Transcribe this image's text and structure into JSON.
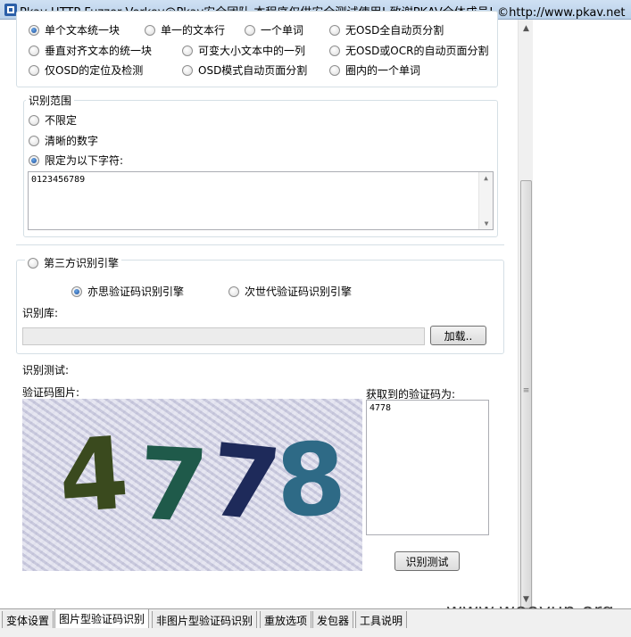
{
  "window": {
    "title": "Pkav HTTP Fuzzer   Verkey@Pkav安全团队  本程序仅供安全测试使用! 致谢PKAV全体成员! ©http://www.pkav.net"
  },
  "osd_modes": {
    "row1": [
      "单个文本统一块",
      "单一的文本行",
      "一个单词",
      "无OSD全自动页分割"
    ],
    "row2": [
      "垂直对齐文本的统一块",
      "可变大小文本中的一列",
      "无OSD或OCR的自动页面分割"
    ],
    "row3": [
      "仅OSD的定位及检测",
      "OSD模式自动页面分割",
      "圈内的一个单词"
    ]
  },
  "range": {
    "legend": "识别范围",
    "opt_none": "不限定",
    "opt_digits": "清晰的数字",
    "opt_custom": "限定为以下字符:",
    "charset": "0123456789"
  },
  "third_party": {
    "legend": "第三方识别引擎",
    "engine_yisi": "亦思验证码识别引擎",
    "engine_next": "次世代验证码识别引擎",
    "lib_label": "识别库:",
    "lib_path": "",
    "load_button": "加载.."
  },
  "test": {
    "label": "识别测试:",
    "image_label": "验证码图片:",
    "result_label": "获取到的验证码为:",
    "result": "4778",
    "captcha_text": "4778",
    "button": "识别测试"
  },
  "tabs": [
    "变体设置",
    "图片型验证码识别",
    "非图片型验证码识别",
    "重放选项",
    "发包器",
    "工具说明"
  ],
  "active_tab": "图片型验证码识别",
  "watermark": "www.wooyun.org"
}
